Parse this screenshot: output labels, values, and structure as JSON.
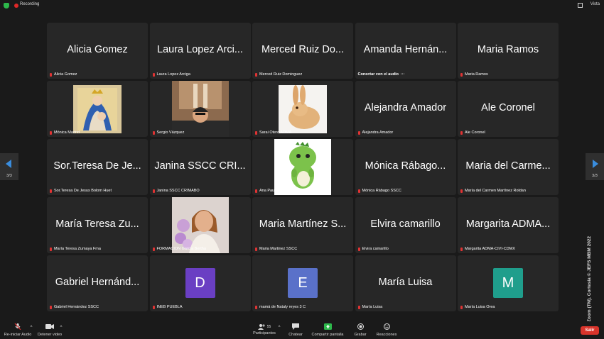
{
  "topbar": {
    "recording": "Recording",
    "view": "Vista"
  },
  "pager": {
    "left": "3/3",
    "right": "3/3"
  },
  "watermark": "Zoom (TM). Cortesía © JEFS MBM 2022",
  "tiles": [
    {
      "name": "Alicia Gomez",
      "label": "Alicia Gomez"
    },
    {
      "name": "Laura Lopez Arci...",
      "label": "Laura Lopez Arciga"
    },
    {
      "name": "Merced Ruiz Do...",
      "label": "Merced Ruiz Dominguez"
    },
    {
      "name": "Amanda Hernán...",
      "label": "Conectar con el audio"
    },
    {
      "name": "Maria Ramos",
      "label": "Maria Ramos"
    },
    {
      "label": "Mónica Madrid"
    },
    {
      "label": "Sergio Vázquez"
    },
    {
      "label": "Sarai Otero ADMA"
    },
    {
      "name": "Alejandra Amador",
      "label": "Alejandra Amador"
    },
    {
      "name": "Ale Coronel",
      "label": "Ale Coronel"
    },
    {
      "name": "Sor.Teresa De Je...",
      "label": "Sor.Teresa De Jesus Bolom Huet"
    },
    {
      "name": "Janina SSCC CRI...",
      "label": "Janina SSCC CRIMABO"
    },
    {
      "label": "Ana Pau"
    },
    {
      "name": "Mónica Rábago...",
      "label": "Mónica Rábago SSCC"
    },
    {
      "name": "Maria del Carme...",
      "label": "María del Carmen Martínez Roldan"
    },
    {
      "name": "María Teresa Zu...",
      "label": "María Teresa Zumaya Fma"
    },
    {
      "label": "FORMACION García Bertha"
    },
    {
      "name": "Maria Martínez S...",
      "label": "Maria Martinez SSCC"
    },
    {
      "name": "Elvira camarillo",
      "label": "Elvira camarillo"
    },
    {
      "name": "Margarita ADMA...",
      "label": "Margarita ADMA-CIVI-CDMX"
    },
    {
      "name": "Gabriel Hernánd...",
      "label": "Gabriel Hernández SSCC"
    },
    {
      "avatar": "D",
      "label": "INEB PUEBLA"
    },
    {
      "avatar": "E",
      "label": "mamá de Nataly reyes 3 C"
    },
    {
      "name": "María Luisa",
      "label": "María Luisa"
    },
    {
      "avatar": "M",
      "label": "María Luisa Orea"
    }
  ],
  "avatar_colors": {
    "D": "#6a3fc3",
    "E": "#5a71c9",
    "M": "#1f9e8c"
  },
  "toolbar": {
    "audio": "Re-iniciar Audio",
    "video": "Detener video",
    "participants": "Participantes",
    "participants_count": "55",
    "chat": "Chatear",
    "share": "Compartir pantalla",
    "record": "Grabar",
    "reactions": "Reacciones",
    "leave": "Salir"
  }
}
